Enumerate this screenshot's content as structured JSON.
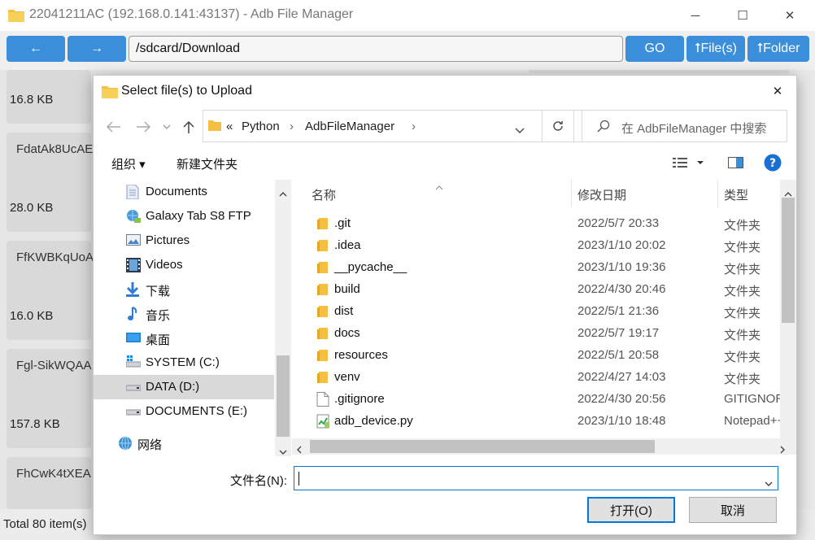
{
  "window": {
    "title": "22041211AC (192.168.0.141:43137) - Adb File Manager",
    "minimize": "─",
    "maximize": "☐",
    "close": "✕"
  },
  "toolbar": {
    "back": "←",
    "forward": "→",
    "path": "/sdcard/Download",
    "go": "GO",
    "upload_files": "⭡File(s)",
    "upload_folder": "⭡Folder"
  },
  "files": [
    {
      "name": "",
      "size": "16.8 KB"
    },
    {
      "name": "FdatAk8UcAE",
      "size": "28.0 KB"
    },
    {
      "name": "FfKWBKqUoA",
      "size": "16.0 KB"
    },
    {
      "name": "Fgl-SikWQAA",
      "size": "157.8 KB"
    },
    {
      "name": "FhCwK4tXEA",
      "size": ""
    }
  ],
  "status": {
    "total": "Total 80 item(s)"
  },
  "dialog": {
    "title": "Select file(s) to Upload",
    "close": "✕",
    "breadcrumb": {
      "prefix": "«",
      "items": [
        "Python",
        "AdbFileManager"
      ]
    },
    "search_placeholder": "在 AdbFileManager 中搜索",
    "commands": {
      "organize": "组织 ▾",
      "new_folder": "新建文件夹"
    },
    "tree": [
      {
        "label": "Documents",
        "icon": "documents-icon"
      },
      {
        "label": "Galaxy Tab S8 FTP",
        "icon": "network-location-icon"
      },
      {
        "label": "Pictures",
        "icon": "pictures-icon"
      },
      {
        "label": "Videos",
        "icon": "videos-icon"
      },
      {
        "label": "下载",
        "icon": "downloads-icon"
      },
      {
        "label": "音乐",
        "icon": "music-icon"
      },
      {
        "label": "桌面",
        "icon": "desktop-icon"
      },
      {
        "label": "SYSTEM (C:)",
        "icon": "drive-c-icon"
      },
      {
        "label": "DATA (D:)",
        "icon": "drive-icon",
        "selected": true
      },
      {
        "label": "DOCUMENTS (E:)",
        "icon": "drive-icon"
      },
      {
        "label": "网络",
        "icon": "network-icon"
      }
    ],
    "columns": {
      "name": "名称",
      "modified": "修改日期",
      "type": "类型"
    },
    "rows": [
      {
        "name": ".git",
        "date": "2022/5/7 20:33",
        "type": "文件夹",
        "kind": "folder"
      },
      {
        "name": ".idea",
        "date": "2023/1/10 20:02",
        "type": "文件夹",
        "kind": "folder"
      },
      {
        "name": "__pycache__",
        "date": "2023/1/10 19:36",
        "type": "文件夹",
        "kind": "folder"
      },
      {
        "name": "build",
        "date": "2022/4/30 20:46",
        "type": "文件夹",
        "kind": "folder"
      },
      {
        "name": "dist",
        "date": "2022/5/1 21:36",
        "type": "文件夹",
        "kind": "folder"
      },
      {
        "name": "docs",
        "date": "2022/5/7 19:17",
        "type": "文件夹",
        "kind": "folder"
      },
      {
        "name": "resources",
        "date": "2022/5/1 20:58",
        "type": "文件夹",
        "kind": "folder"
      },
      {
        "name": "venv",
        "date": "2022/4/27 14:03",
        "type": "文件夹",
        "kind": "folder"
      },
      {
        "name": ".gitignore",
        "date": "2022/4/30 20:56",
        "type": "GITIGNORE",
        "kind": "file"
      },
      {
        "name": "adb_device.py",
        "date": "2023/1/10 18:48",
        "type": "Notepad++",
        "kind": "py"
      }
    ],
    "filename_label": "文件名(N):",
    "filename_value": "",
    "open_button": "打开(O)",
    "cancel_button": "取消"
  },
  "colors": {
    "accent": "#3b8ed9",
    "folder": "#f5c042",
    "focus": "#0078d7"
  }
}
